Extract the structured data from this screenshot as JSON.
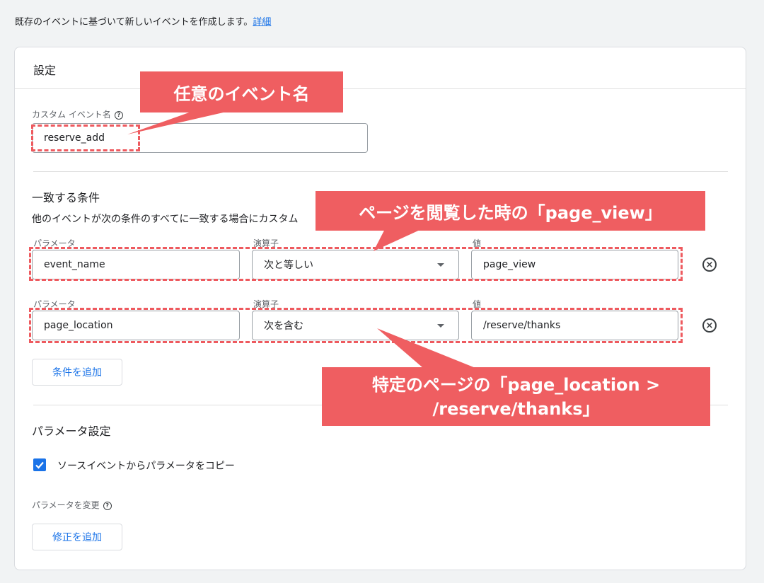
{
  "intro": {
    "text": "既存のイベントに基づいて新しいイベントを作成します。",
    "link": "詳細"
  },
  "card": {
    "title": "設定"
  },
  "custom_event": {
    "label": "カスタム イベント名",
    "help": "?",
    "value": "reserve_add"
  },
  "matching": {
    "title": "一致する条件",
    "description": "他のイベントが次の条件のすべてに一致する場合にカスタム",
    "rows": [
      {
        "param_label": "パラメータ",
        "param_value": "event_name",
        "op_label": "演算子",
        "op_value": "次と等しい",
        "val_label": "値",
        "val_value": "page_view"
      },
      {
        "param_label": "パラメータ",
        "param_value": "page_location",
        "op_label": "演算子",
        "op_value": "次を含む",
        "val_label": "値",
        "val_value": "/reserve/thanks"
      }
    ],
    "add_condition": "条件を追加"
  },
  "param_settings": {
    "title": "パラメータ設定",
    "copy_label": "ソースイベントからパラメータをコピー",
    "copy_checked": true,
    "modify_label": "パラメータを変更",
    "modify_help": "?",
    "add_modification": "修正を追加"
  },
  "annotations": {
    "a1": "任意のイベント名",
    "a2": "ページを閲覧した時の「page_view」",
    "a3_line1": "特定のページの「page_location >",
    "a3_line2": "/reserve/thanks」"
  },
  "icons": {
    "help": "help-circle-icon",
    "remove": "remove-circle-icon",
    "dropdown": "caret-down-icon",
    "check": "check-icon"
  },
  "colors": {
    "accent": "#1a73e8",
    "annotation": "#ef5e61"
  }
}
